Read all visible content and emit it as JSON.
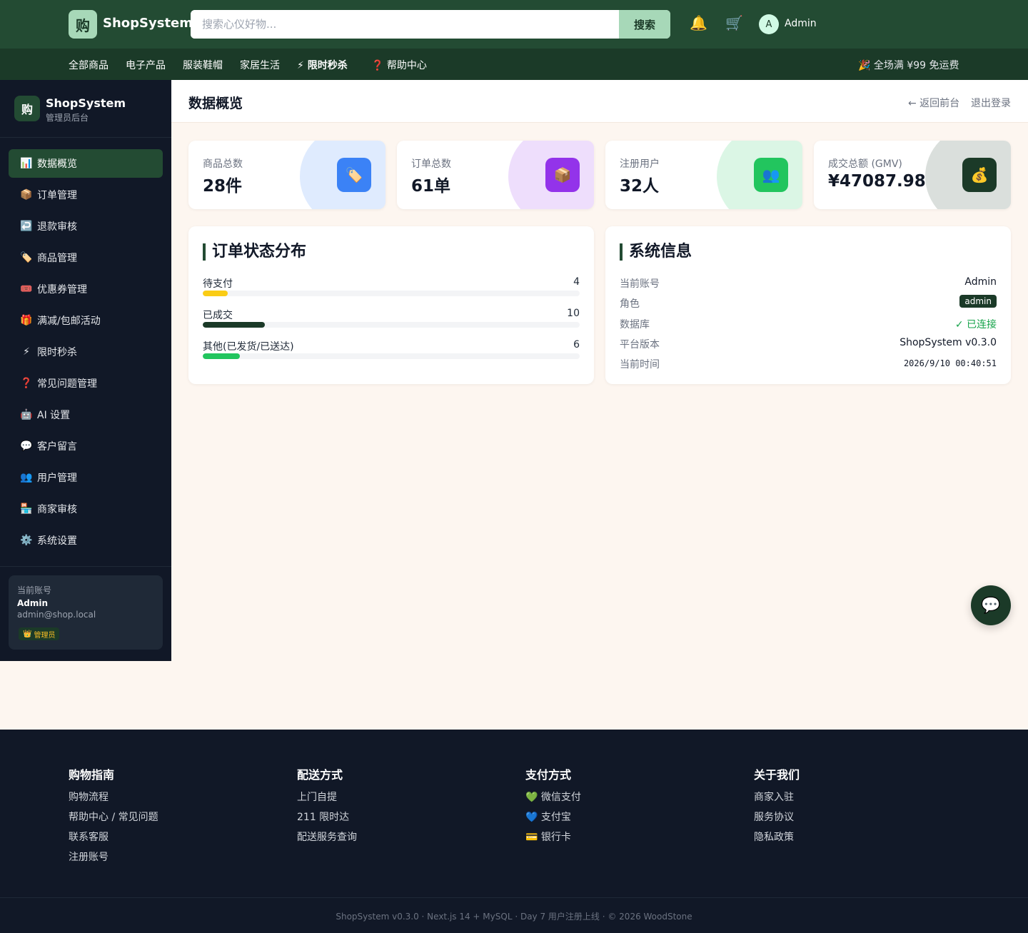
{
  "header": {
    "logo_char": "购",
    "brand": "ShopSystem",
    "search_placeholder": "搜索心仪好物...",
    "search_button": "搜索",
    "bell_icon": "🔔",
    "cart_icon": "🛒",
    "avatar_initial": "A",
    "user_name": "Admin"
  },
  "nav": {
    "items": [
      "全部商品",
      "电子产品",
      "服装鞋帽",
      "家居生活",
      "⚡ 限时秒杀",
      "❓ 帮助中心"
    ],
    "promo": "🎉 全场满 ¥99 免运费"
  },
  "sidebar": {
    "logo_char": "购",
    "title": "ShopSystem",
    "subtitle": "管理员后台",
    "items": [
      {
        "icon": "📊",
        "label": "数据概览"
      },
      {
        "icon": "📦",
        "label": "订单管理"
      },
      {
        "icon": "↩️",
        "label": "退款审核"
      },
      {
        "icon": "🏷️",
        "label": "商品管理"
      },
      {
        "icon": "🎟️",
        "label": "优惠券管理"
      },
      {
        "icon": "🎁",
        "label": "满减/包邮活动"
      },
      {
        "icon": "⚡",
        "label": "限时秒杀"
      },
      {
        "icon": "❓",
        "label": "常见问题管理"
      },
      {
        "icon": "🤖",
        "label": "AI 设置"
      },
      {
        "icon": "💬",
        "label": "客户留言"
      },
      {
        "icon": "👥",
        "label": "用户管理"
      },
      {
        "icon": "🏪",
        "label": "商家审核"
      },
      {
        "icon": "⚙️",
        "label": "系统设置"
      }
    ],
    "account": {
      "label": "当前账号",
      "name": "Admin",
      "email": "admin@shop.local",
      "badge_icon": "👑",
      "badge": "管理员"
    }
  },
  "main": {
    "title": "数据概览",
    "back_link": "← 返回前台",
    "logout": "退出登录",
    "stats": [
      {
        "label": "商品总数",
        "value": "28件",
        "icon": "🏷️",
        "color": "#3b82f6"
      },
      {
        "label": "订单总数",
        "value": "61单",
        "icon": "📦",
        "color": "#9333ea"
      },
      {
        "label": "注册用户",
        "value": "32人",
        "icon": "👥",
        "color": "#22c55e"
      },
      {
        "label": "成交总额 (GMV)",
        "value": "¥47087.98",
        "icon": "💰",
        "color": "#1b3a28"
      }
    ],
    "order_panel": {
      "title": "订单状态分布",
      "rows": [
        {
          "label": "待支付",
          "count": "4",
          "value": 4,
          "color": "#facc15"
        },
        {
          "label": "已成交",
          "count": "10",
          "value": 10,
          "color": "#1b3a28"
        },
        {
          "label": "其他(已发货/已送达)",
          "count": "6",
          "value": 6,
          "color": "#22c55e"
        }
      ],
      "max": 61
    },
    "system_panel": {
      "title": "系统信息",
      "rows": [
        {
          "key": "当前账号",
          "value": "Admin"
        },
        {
          "key": "角色",
          "value": "admin"
        },
        {
          "key": "数据库",
          "value": "✓ 已连接"
        },
        {
          "key": "平台版本",
          "value": "ShopSystem v0.3.0"
        },
        {
          "key": "当前时间",
          "value": "2026/9/10 00:40:51"
        }
      ]
    },
    "chat_icon": "💬"
  },
  "footer": {
    "columns": [
      {
        "title": "购物指南",
        "links": [
          "购物流程",
          "帮助中心 / 常见问题",
          "联系客服",
          "注册账号"
        ]
      },
      {
        "title": "配送方式",
        "links": [
          "上门自提",
          "211 限时达",
          "配送服务查询"
        ]
      },
      {
        "title": "支付方式",
        "links": [
          "💚 微信支付",
          "💙 支付宝",
          "💳 银行卡"
        ]
      },
      {
        "title": "关于我们",
        "links": [
          "商家入驻",
          "服务协议",
          "隐私政策"
        ]
      }
    ],
    "copyright": "ShopSystem v0.3.0 · Next.js 14 + MySQL · Day 7 用户注册上线 · © 2026 WoodStone"
  }
}
